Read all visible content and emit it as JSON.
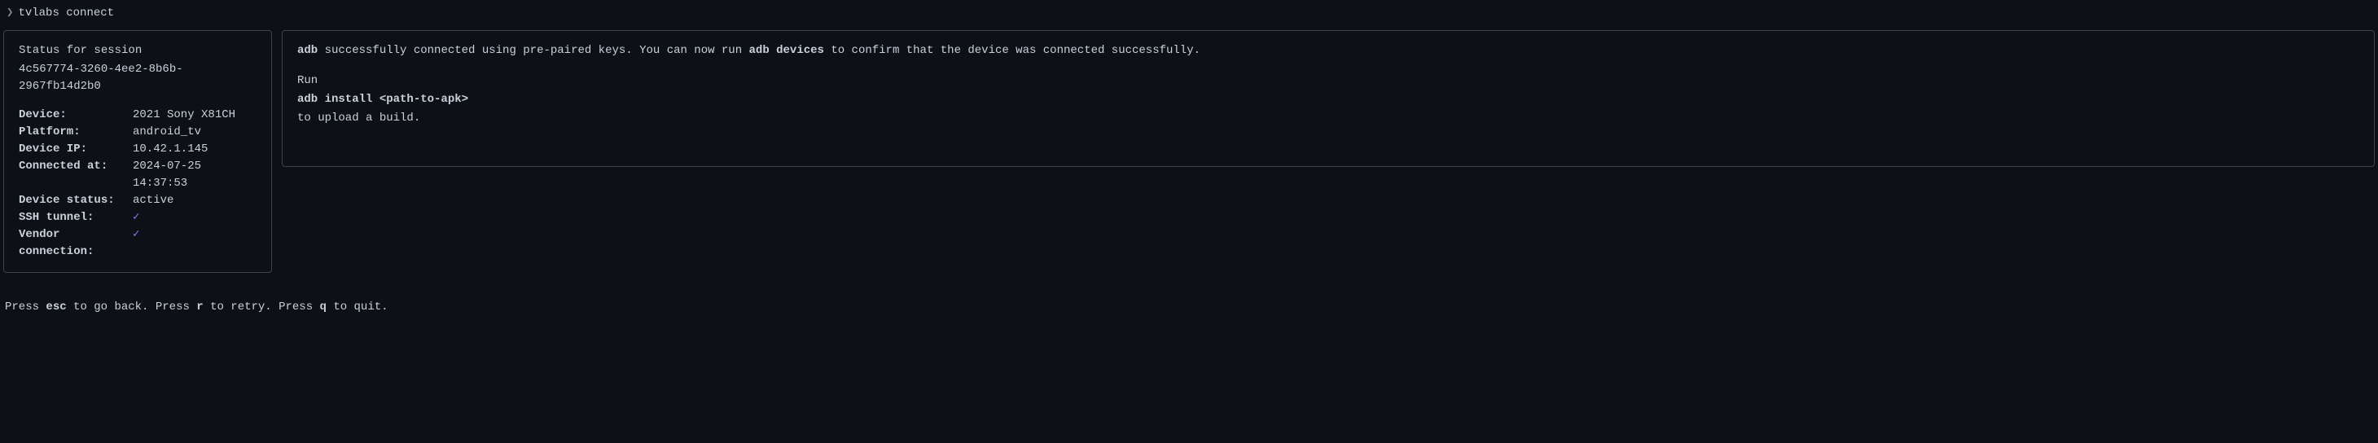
{
  "prompt": {
    "symbol": "❯",
    "command": "tvlabs connect"
  },
  "status": {
    "title": "Status for session",
    "session_id": "4c567774-3260-4ee2-8b6b-2967fb14d2b0",
    "rows": [
      {
        "label": "Device:",
        "value": "2021 Sony X81CH"
      },
      {
        "label": "Platform:",
        "value": "android_tv"
      },
      {
        "label": "Device IP:",
        "value": "10.42.1.145"
      },
      {
        "label": "Connected at:",
        "value": "2024-07-25 14:37:53"
      },
      {
        "label": "Device status:",
        "value": "active"
      },
      {
        "label": "SSH tunnel:",
        "value": "✓",
        "check": true
      },
      {
        "label": "Vendor connection:",
        "value": "✓",
        "check": true
      }
    ]
  },
  "message": {
    "line1_parts": {
      "bold1": "adb",
      "text1": " successfully connected using pre-paired keys. You can now run ",
      "bold2": "adb devices",
      "text2": " to confirm that the device was connected successfully."
    },
    "line2": "Run",
    "line3": "adb install <path-to-apk>",
    "line4": "to upload a build."
  },
  "footer": {
    "text1": "Press ",
    "key1": "esc",
    "text2": " to go back. Press ",
    "key2": "r",
    "text3": " to retry. Press ",
    "key3": "q",
    "text4": " to quit."
  }
}
